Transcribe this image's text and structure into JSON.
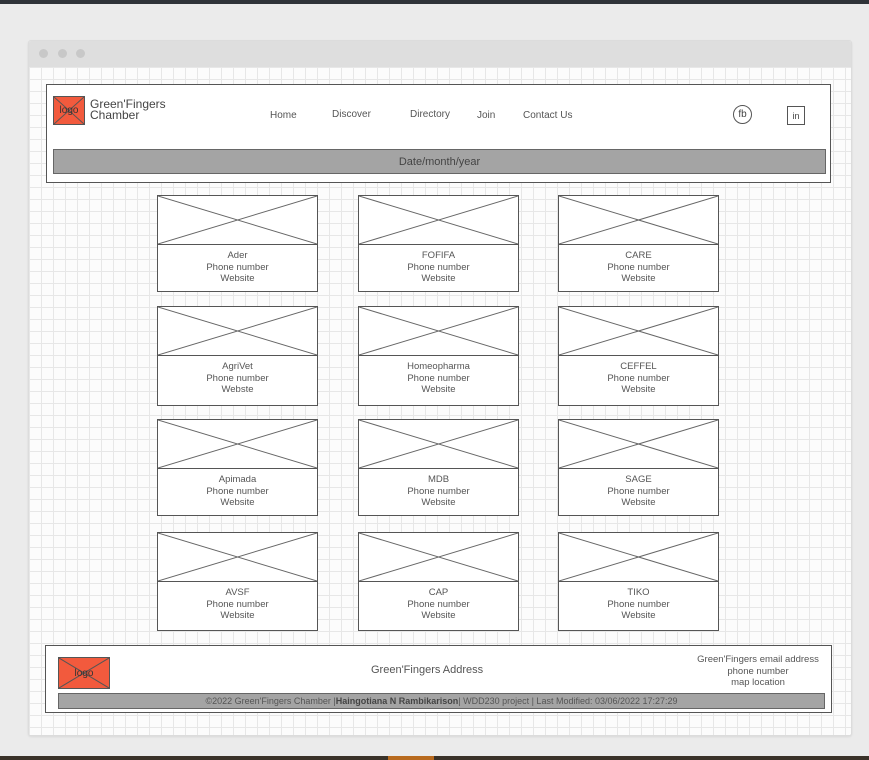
{
  "header": {
    "logo_text": "logo",
    "brand_line1": "Green'Fingers",
    "brand_line2": "Chamber",
    "nav": [
      "Home",
      "Discover",
      "Directory",
      "Join",
      "Contact Us"
    ],
    "social": {
      "facebook": "fb",
      "linkedin": "in"
    },
    "date_placeholder": "Date/month/year"
  },
  "directory": [
    {
      "name": "Ader",
      "phone": "Phone number",
      "website": "Website"
    },
    {
      "name": "FOFIFA",
      "phone": "Phone number",
      "website": "Website"
    },
    {
      "name": "CARE",
      "phone": "Phone number",
      "website": "Website"
    },
    {
      "name": "AgriVet",
      "phone": "Phone number",
      "website": "Webste"
    },
    {
      "name": "Homeopharma",
      "phone": "Phone number",
      "website": "Website"
    },
    {
      "name": "CEFFEL",
      "phone": "Phone number",
      "website": "Website"
    },
    {
      "name": "Apimada",
      "phone": "Phone number",
      "website": "Website"
    },
    {
      "name": "MDB",
      "phone": "Phone number",
      "website": "Website"
    },
    {
      "name": "SAGE",
      "phone": "Phone number",
      "website": "Website"
    },
    {
      "name": "AVSF",
      "phone": "Phone number",
      "website": "Website"
    },
    {
      "name": "CAP",
      "phone": "Phone number",
      "website": "Website"
    },
    {
      "name": "TIKO",
      "phone": "Phone number",
      "website": "Website"
    }
  ],
  "footer": {
    "logo_text": "logo",
    "address": "Green'Fingers Address",
    "email": "Green'Fingers email address",
    "phone": "phone number",
    "map": "map location",
    "copyright_pre": "©2022 Green'Fingers Chamber |",
    "author": "Haingotiana N Rambikarison",
    "copyright_post": "| WDD230 project | Last Modified: 03/06/2022 17:27:29"
  },
  "colors": {
    "logo_fill": "#f25a3d",
    "bar_gray": "#a4a4a4"
  }
}
